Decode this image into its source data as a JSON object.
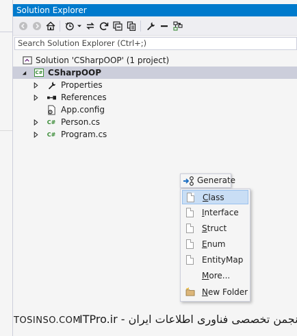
{
  "window": {
    "title": "Solution Explorer"
  },
  "toolbar": {
    "buttons": [
      {
        "name": "back-icon",
        "enabled": false
      },
      {
        "name": "forward-icon",
        "enabled": false
      },
      {
        "name": "home-icon",
        "enabled": true
      },
      {
        "name": "history-icon",
        "enabled": true
      },
      {
        "name": "sync-icon",
        "enabled": true
      },
      {
        "name": "refresh-icon",
        "enabled": true
      },
      {
        "name": "collapse-all-icon",
        "enabled": true
      },
      {
        "name": "show-all-files-icon",
        "enabled": true
      },
      {
        "name": "properties-icon",
        "enabled": true
      },
      {
        "name": "minus-icon",
        "enabled": true
      },
      {
        "name": "diagram-icon",
        "enabled": true
      }
    ]
  },
  "search": {
    "placeholder": "Search Solution Explorer (Ctrl+;)"
  },
  "tree": {
    "solution": "Solution 'CSharpOOP' (1 project)",
    "project": "CSharpOOP",
    "items": [
      {
        "label": "Properties",
        "icon": "wrench-icon",
        "expandable": true
      },
      {
        "label": "References",
        "icon": "references-icon",
        "expandable": true
      },
      {
        "label": "App.config",
        "icon": "config-icon",
        "expandable": false
      },
      {
        "label": "Person.cs",
        "icon": "csharp-file-icon",
        "expandable": true
      },
      {
        "label": "Program.cs",
        "icon": "csharp-file-icon",
        "expandable": true
      }
    ]
  },
  "context_menu": {
    "generate_label": "Generate",
    "submenu": [
      {
        "label": "Class",
        "mnemonic": "C",
        "rest": "lass",
        "highlighted": true
      },
      {
        "label": "Interface",
        "mnemonic": "I",
        "rest": "nterface",
        "highlighted": false
      },
      {
        "label": "Struct",
        "mnemonic": "S",
        "rest": "truct",
        "highlighted": false
      },
      {
        "label": "Enum",
        "mnemonic": "E",
        "rest": "num",
        "highlighted": false
      },
      {
        "label": "EntityMap",
        "mnemonic": "",
        "rest": "EntityMap",
        "highlighted": false
      },
      {
        "label": "More...",
        "mnemonic": "M",
        "rest": "ore...",
        "highlighted": false
      },
      {
        "label": "New Folder",
        "mnemonic": "N",
        "rest": "ew Folder",
        "highlighted": false
      }
    ]
  },
  "watermark": {
    "left": "TOSINSO.COM",
    "right": "ITPro.ir - انجمن تخصصی فناوری اطلاعات ایران"
  },
  "colors": {
    "accent": "#007acc",
    "panel_bg": "#f5f5f5",
    "selection": "#cccedb",
    "menu_hover": "#c9def5",
    "csharp_green": "#388a34"
  }
}
